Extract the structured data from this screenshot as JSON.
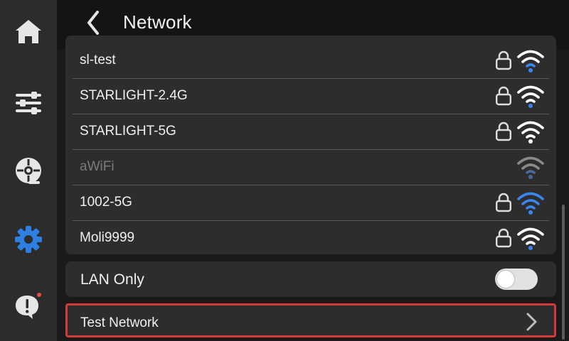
{
  "header": {
    "title": "Network",
    "back_icon": "chevron-left-icon"
  },
  "sidebar": {
    "items": [
      {
        "name": "home",
        "icon": "home-icon",
        "active": false
      },
      {
        "name": "controls",
        "icon": "sliders-icon",
        "active": false
      },
      {
        "name": "filament",
        "icon": "spool-icon",
        "active": false
      },
      {
        "name": "settings",
        "icon": "gear-icon",
        "active": true
      },
      {
        "name": "notifications",
        "icon": "alert-bubble-icon",
        "active": false,
        "has_badge": true
      }
    ]
  },
  "wifi_list": [
    {
      "ssid": "sl-test",
      "secured": true,
      "signal_color": "#ffffff",
      "dimmed": false
    },
    {
      "ssid": "STARLIGHT-2.4G",
      "secured": true,
      "signal_color": "#ffffff",
      "dimmed": false
    },
    {
      "ssid": "STARLIGHT-5G",
      "secured": true,
      "signal_color": "#ffffff",
      "dimmed": false
    },
    {
      "ssid": "aWiFi",
      "secured": false,
      "signal_color": "#8a8a8a",
      "dimmed": true
    },
    {
      "ssid": "1002-5G",
      "secured": true,
      "signal_color": "#3a86f0",
      "dimmed": false
    },
    {
      "ssid": "Moli9999",
      "secured": true,
      "signal_color": "#ffffff",
      "dimmed": false
    }
  ],
  "lan": {
    "label": "LAN Only",
    "enabled": false
  },
  "test_network": {
    "label": "Test Network"
  },
  "colors": {
    "accent": "#2f7fe3",
    "highlight_border": "#d43a3a",
    "badge": "#e0504a"
  }
}
